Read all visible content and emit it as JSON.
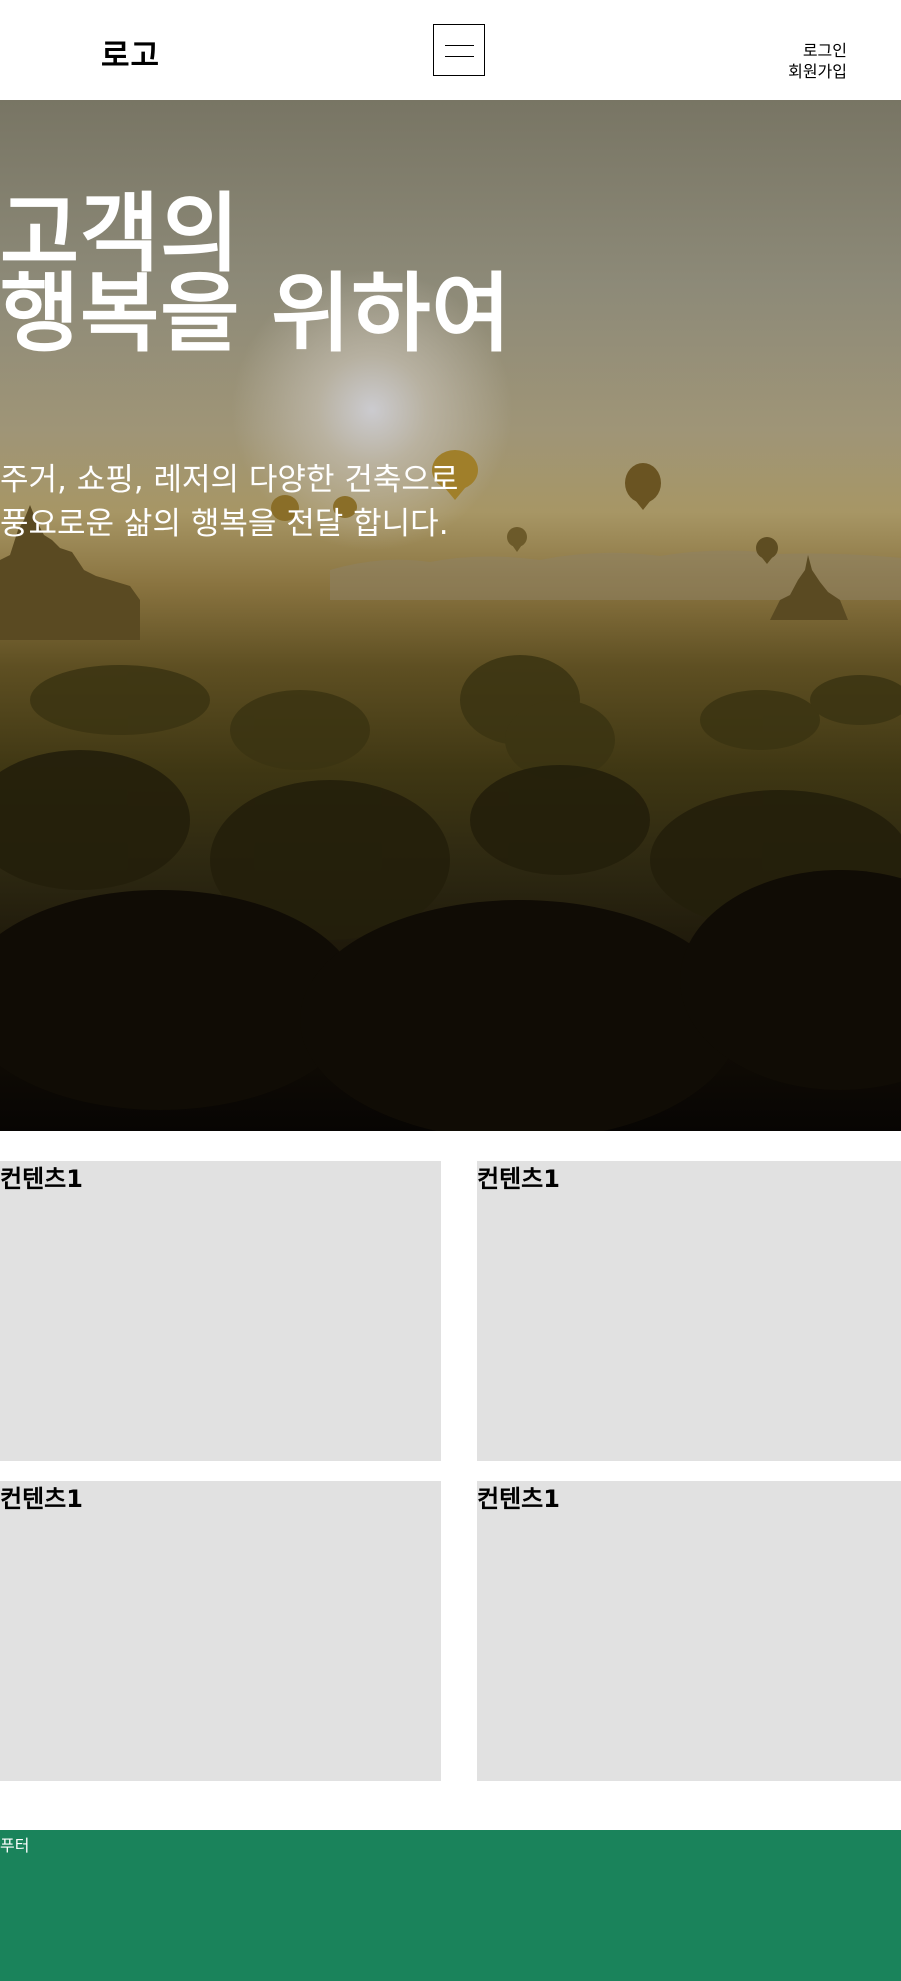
{
  "header": {
    "logo": "로고",
    "menu_icon": "hamburger-menu-icon",
    "login_link": "로그인",
    "signup_link": "회원가입"
  },
  "hero": {
    "title_line1": "고객의",
    "title_line2": "행복을 위하여",
    "subtitle_line1": "주거, 쇼핑, 레저의 다양한 건축으로",
    "subtitle_line2": "풍요로운 삶의 행복을 전달 합니다.",
    "background": "hot-air-balloons-over-bagan-landscape-photo"
  },
  "contents": [
    {
      "title": "컨텐츠1"
    },
    {
      "title": "컨텐츠1"
    },
    {
      "title": "컨텐츠1"
    },
    {
      "title": "컨텐츠1"
    }
  ],
  "footer": {
    "label": "푸터"
  },
  "colors": {
    "footer_bg": "#1a835b",
    "card_bg": "#e1e1e1",
    "hero_text": "#ffffff"
  }
}
